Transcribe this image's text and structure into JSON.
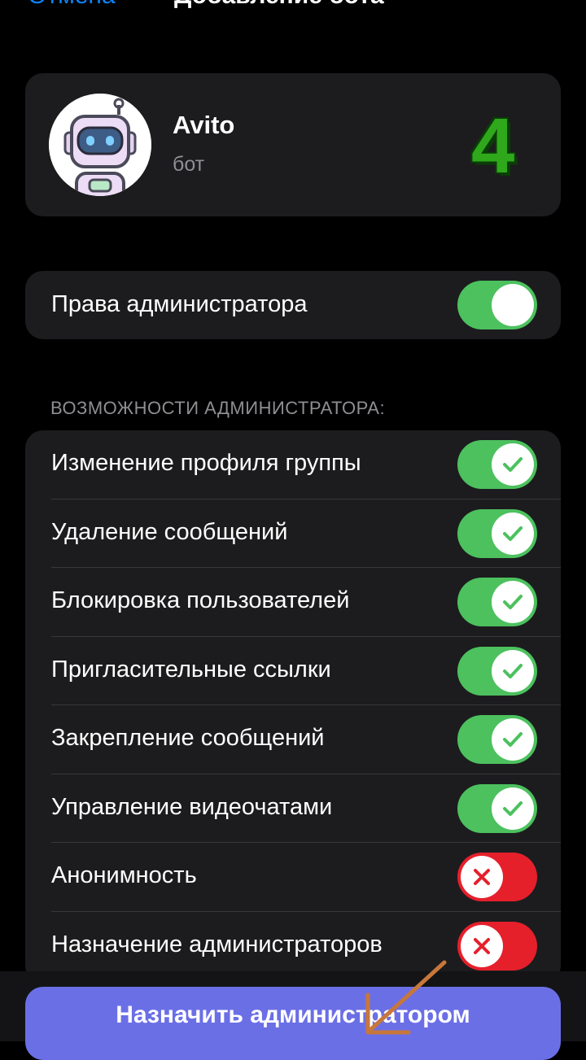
{
  "nav": {
    "back_label": "Отмена",
    "title": "Добавление бота"
  },
  "profile": {
    "name": "Avito",
    "subtitle": "бот",
    "annotation_number": "4"
  },
  "admin_rights": {
    "label": "Права администратора",
    "enabled": true
  },
  "section_header": "ВОЗМОЖНОСТИ АДМИНИСТРАТОРА:",
  "permissions": [
    {
      "label": "Изменение профиля группы",
      "enabled": true
    },
    {
      "label": "Удаление сообщений",
      "enabled": true
    },
    {
      "label": "Блокировка пользователей",
      "enabled": true
    },
    {
      "label": "Пригласительные ссылки",
      "enabled": true
    },
    {
      "label": "Закрепление сообщений",
      "enabled": true
    },
    {
      "label": "Управление видеочатами",
      "enabled": true
    },
    {
      "label": "Анонимность",
      "enabled": false
    },
    {
      "label": "Назначение администраторов",
      "enabled": false
    }
  ],
  "assign_button": {
    "label": "Назначить администратором"
  },
  "colors": {
    "switch_on": "#4cc15e",
    "switch_off": "#e5202b",
    "button": "#6b6fe6",
    "annotation_arrow": "#c8773a",
    "annotation_number": "#2fa81c"
  },
  "icons": {
    "on": "checkmark-icon",
    "off": "cross-icon",
    "avatar": "robot-avatar"
  }
}
